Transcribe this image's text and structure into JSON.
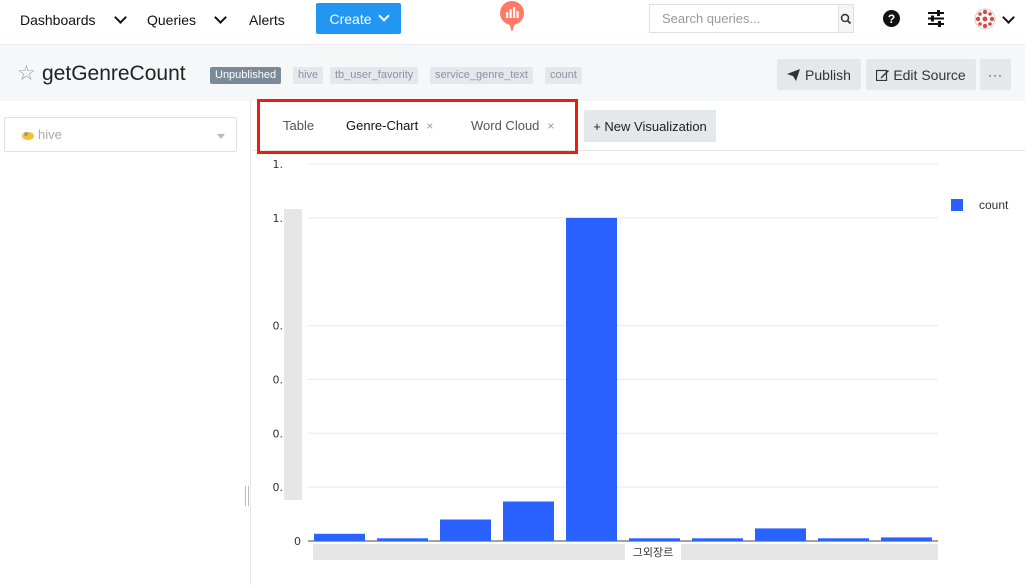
{
  "nav": {
    "dashboards": "Dashboards",
    "queries": "Queries",
    "alerts": "Alerts",
    "create": "Create",
    "search_placeholder": "Search queries...",
    "help_symbol": "?"
  },
  "query": {
    "title": "getGenreCount",
    "status_tag": "Unpublished",
    "tags": [
      "hive",
      "tb_user_favority",
      "service_genre_text",
      "count"
    ],
    "publish_label": "Publish",
    "edit_source_label": "Edit Source",
    "more_label": "···"
  },
  "datasource": {
    "selected": "hive"
  },
  "tabs": {
    "items": [
      {
        "label": "Table",
        "active": false,
        "closable": false
      },
      {
        "label": "Genre-Chart",
        "active": true,
        "closable": true
      },
      {
        "label": "Word Cloud",
        "active": false,
        "closable": true
      }
    ],
    "close_symbol": "×",
    "new_visualization": "+ New Visualization"
  },
  "colors": {
    "accent": "#2196f3",
    "bar": "#2962ff",
    "highlight": "#ef1b0c"
  },
  "chart_data": {
    "type": "bar",
    "categories": [
      "",
      "",
      "",
      "",
      "",
      "그외장르",
      "",
      "",
      "",
      ""
    ],
    "series": [
      {
        "name": "count",
        "values": [
          0.04,
          0.015,
          0.12,
          0.22,
          1.8,
          0.015,
          0.015,
          0.07,
          0.015,
          0.02
        ]
      }
    ],
    "ytick_labels": [
      "0",
      "0.",
      "0.",
      "0.",
      "0.",
      "1.",
      "1."
    ],
    "ytick_values": [
      0,
      0.3,
      0.6,
      0.9,
      1.2,
      1.8,
      2.1
    ],
    "ylim": [
      0,
      2.1
    ],
    "x_visible_label": "그외장르",
    "legend": [
      "count"
    ],
    "legend_position": "top-right",
    "grid": true
  }
}
